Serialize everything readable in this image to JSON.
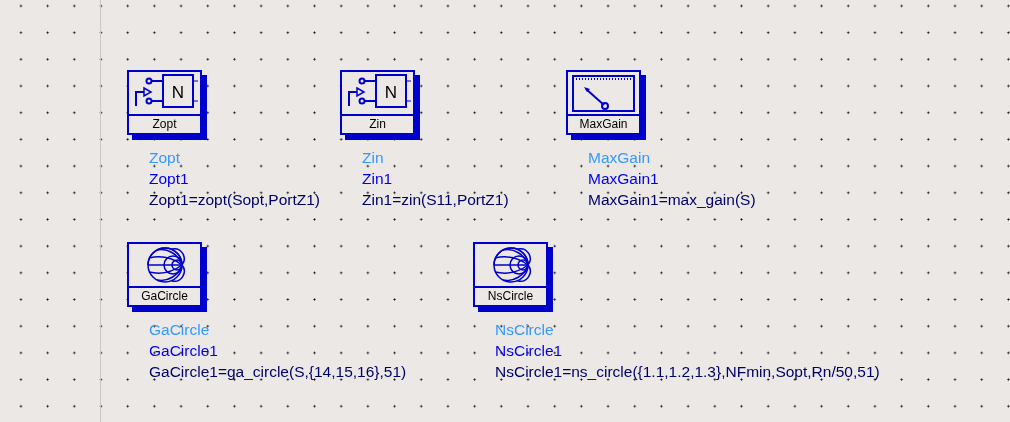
{
  "components": [
    {
      "kind": "twoport",
      "glyph": "N",
      "symbol_label": "Zopt",
      "name": "Zopt",
      "instance": "Zopt1",
      "equation": "Zopt1=zopt(Sopt,PortZ1)"
    },
    {
      "kind": "twoport",
      "glyph": "N",
      "symbol_label": "Zin",
      "name": "Zin",
      "instance": "Zin1",
      "equation": "Zin1=zin(S11,PortZ1)"
    },
    {
      "kind": "meter",
      "symbol_label": "MaxGain",
      "name": "MaxGain",
      "instance": "MaxGain1",
      "equation": "MaxGain1=max_gain(S)"
    },
    {
      "kind": "smith",
      "symbol_label": "GaCircle",
      "name": "GaCircle",
      "instance": "GaCircle1",
      "equation": "GaCircle1=ga_circle(S,{14,15,16},51)"
    },
    {
      "kind": "smith",
      "symbol_label": "NsCircle",
      "name": "NsCircle",
      "instance": "NsCircle1",
      "equation": "NsCircle1=ns_circle({1.1,1.2,1.3},NFmin,Sopt,Rn/50,51)"
    }
  ]
}
